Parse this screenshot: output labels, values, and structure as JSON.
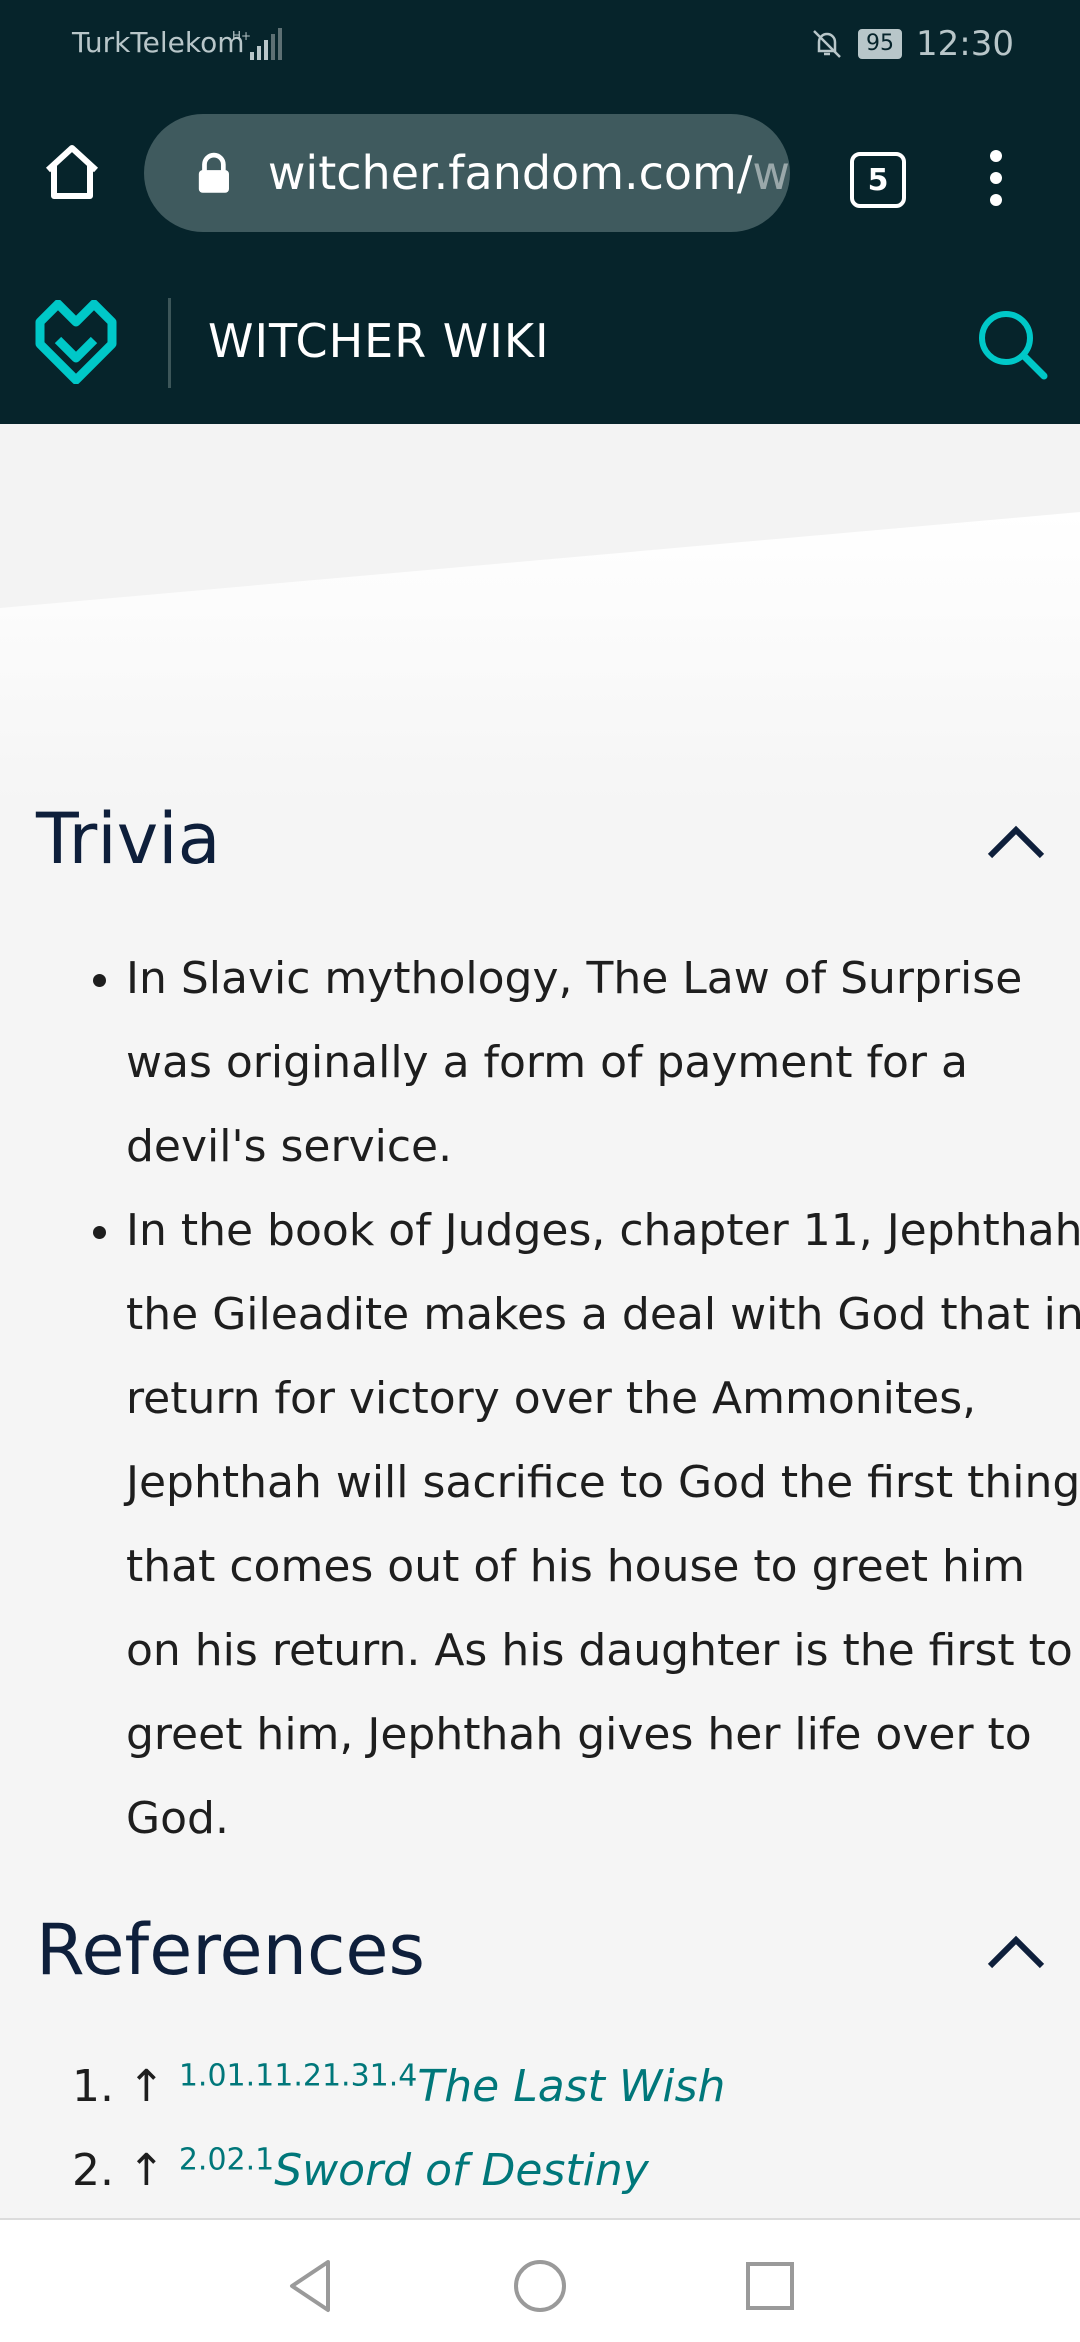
{
  "status": {
    "carrier": "TurkTelekom",
    "battery": "95",
    "time": "12:30"
  },
  "browser": {
    "url_main": "witcher.fandom.com/",
    "url_fade": "w",
    "tab_count": "5"
  },
  "wiki": {
    "title": "WITCHER WIKI"
  },
  "trivia": {
    "heading": "Trivia",
    "items": [
      "In Slavic mythology, The Law of Surprise was originally a form of payment for a devil's service.",
      "In the book of Judges, chapter 11, Jephthah the Gileadite makes a deal with God that in return for victory over the Ammonites, Jephthah will sacrifice to God the first thing that comes out of his house to greet him on his return. As his daughter is the first to greet him, Jephthah gives her life over to God."
    ]
  },
  "references": {
    "heading": "References",
    "items": [
      {
        "num": "1. ↑ ",
        "sup": "1.01.11.21.31.4",
        "title": "The Last Wish"
      },
      {
        "num": "2. ↑ ",
        "sup": "2.02.1",
        "title": "Sword of Destiny"
      }
    ]
  },
  "colors": {
    "header_bg": "#06242b",
    "accent": "#00b8b8",
    "link": "#00777a",
    "heading": "#0e1f3b"
  }
}
